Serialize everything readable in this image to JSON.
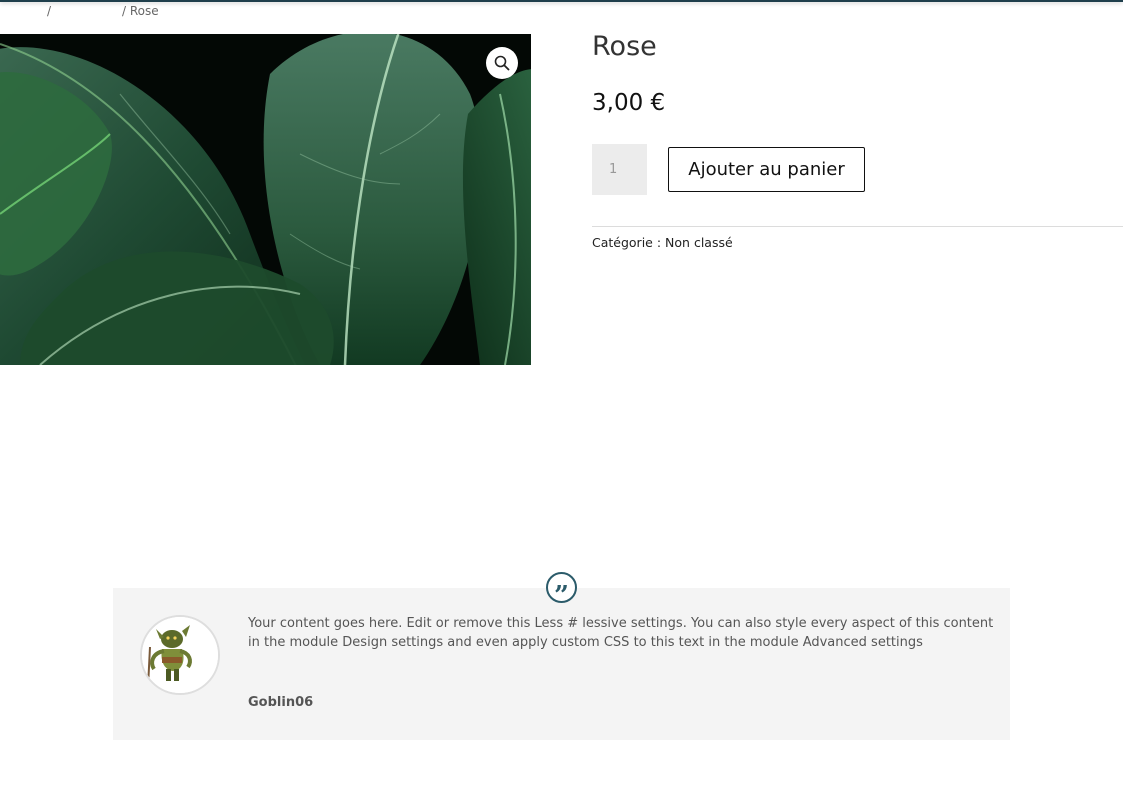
{
  "breadcrumb": {
    "separator_1": "/",
    "current": "/ Rose"
  },
  "product": {
    "title": "Rose",
    "price": "3,00 €",
    "quantity_value": "1",
    "add_to_cart_label": "Ajouter au panier",
    "category_label": "Catégorie :",
    "category_value": "Non classé",
    "image_icon": "zoom-magnifier-icon"
  },
  "testimonial": {
    "text": "Your content goes here. Edit or remove this Less # lessive  settings. You can also style every aspect of this content in the module Design settings and even apply custom CSS to this text in the module Advanced settings",
    "author": "Goblin06",
    "quote_icon": "quote-icon",
    "quote_glyph": "”"
  },
  "colors": {
    "accent": "#2b5b6a",
    "top_bar": "#1f3f4c",
    "testimonial_bg": "#f4f4f4"
  }
}
